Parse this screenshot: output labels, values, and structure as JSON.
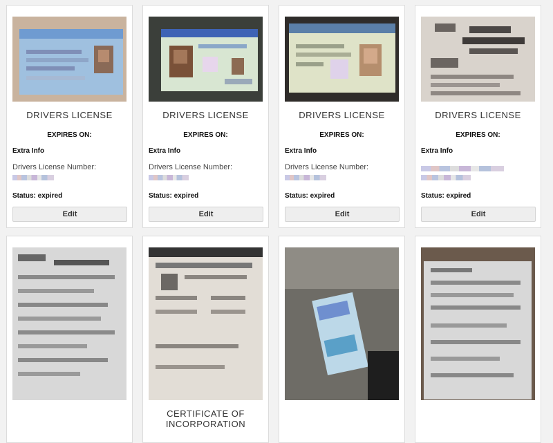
{
  "cards": [
    {
      "title": "DRIVERS LICENSE",
      "expires_label": "EXPIRES ON:",
      "extra_label": "Extra Info",
      "number_label": "Drivers License Number:",
      "status": "Status: expired",
      "edit_label": "Edit",
      "image_desc": "license-photo-1"
    },
    {
      "title": "DRIVERS LICENSE",
      "expires_label": "EXPIRES ON:",
      "extra_label": "Extra Info",
      "number_label": "Drivers License Number:",
      "status": "Status: expired",
      "edit_label": "Edit",
      "image_desc": "license-photo-2"
    },
    {
      "title": "DRIVERS LICENSE",
      "expires_label": "EXPIRES ON:",
      "extra_label": "Extra Info",
      "number_label": "Drivers License Number:",
      "status": "Status: expired",
      "edit_label": "Edit",
      "image_desc": "license-photo-3"
    },
    {
      "title": "DRIVERS LICENSE",
      "expires_label": "EXPIRES ON:",
      "extra_label": "Extra Info",
      "number_label": "",
      "status": "Status: expired",
      "edit_label": "Edit",
      "image_desc": "license-photo-4"
    },
    {
      "title": "",
      "image_desc": "document-photo-5"
    },
    {
      "title": "CERTIFICATE OF INCORPORATION",
      "title_line1": "CERTIFICATE OF",
      "title_line2": "INCORPORATION",
      "image_desc": "document-photo-6"
    },
    {
      "title": "",
      "image_desc": "document-photo-7"
    },
    {
      "title": "",
      "image_desc": "document-photo-8"
    }
  ],
  "colors": {
    "page_bg": "#f2f2f2",
    "card_bg": "#ffffff",
    "card_border": "#dcdcdc",
    "button_bg": "#eeeeee"
  }
}
